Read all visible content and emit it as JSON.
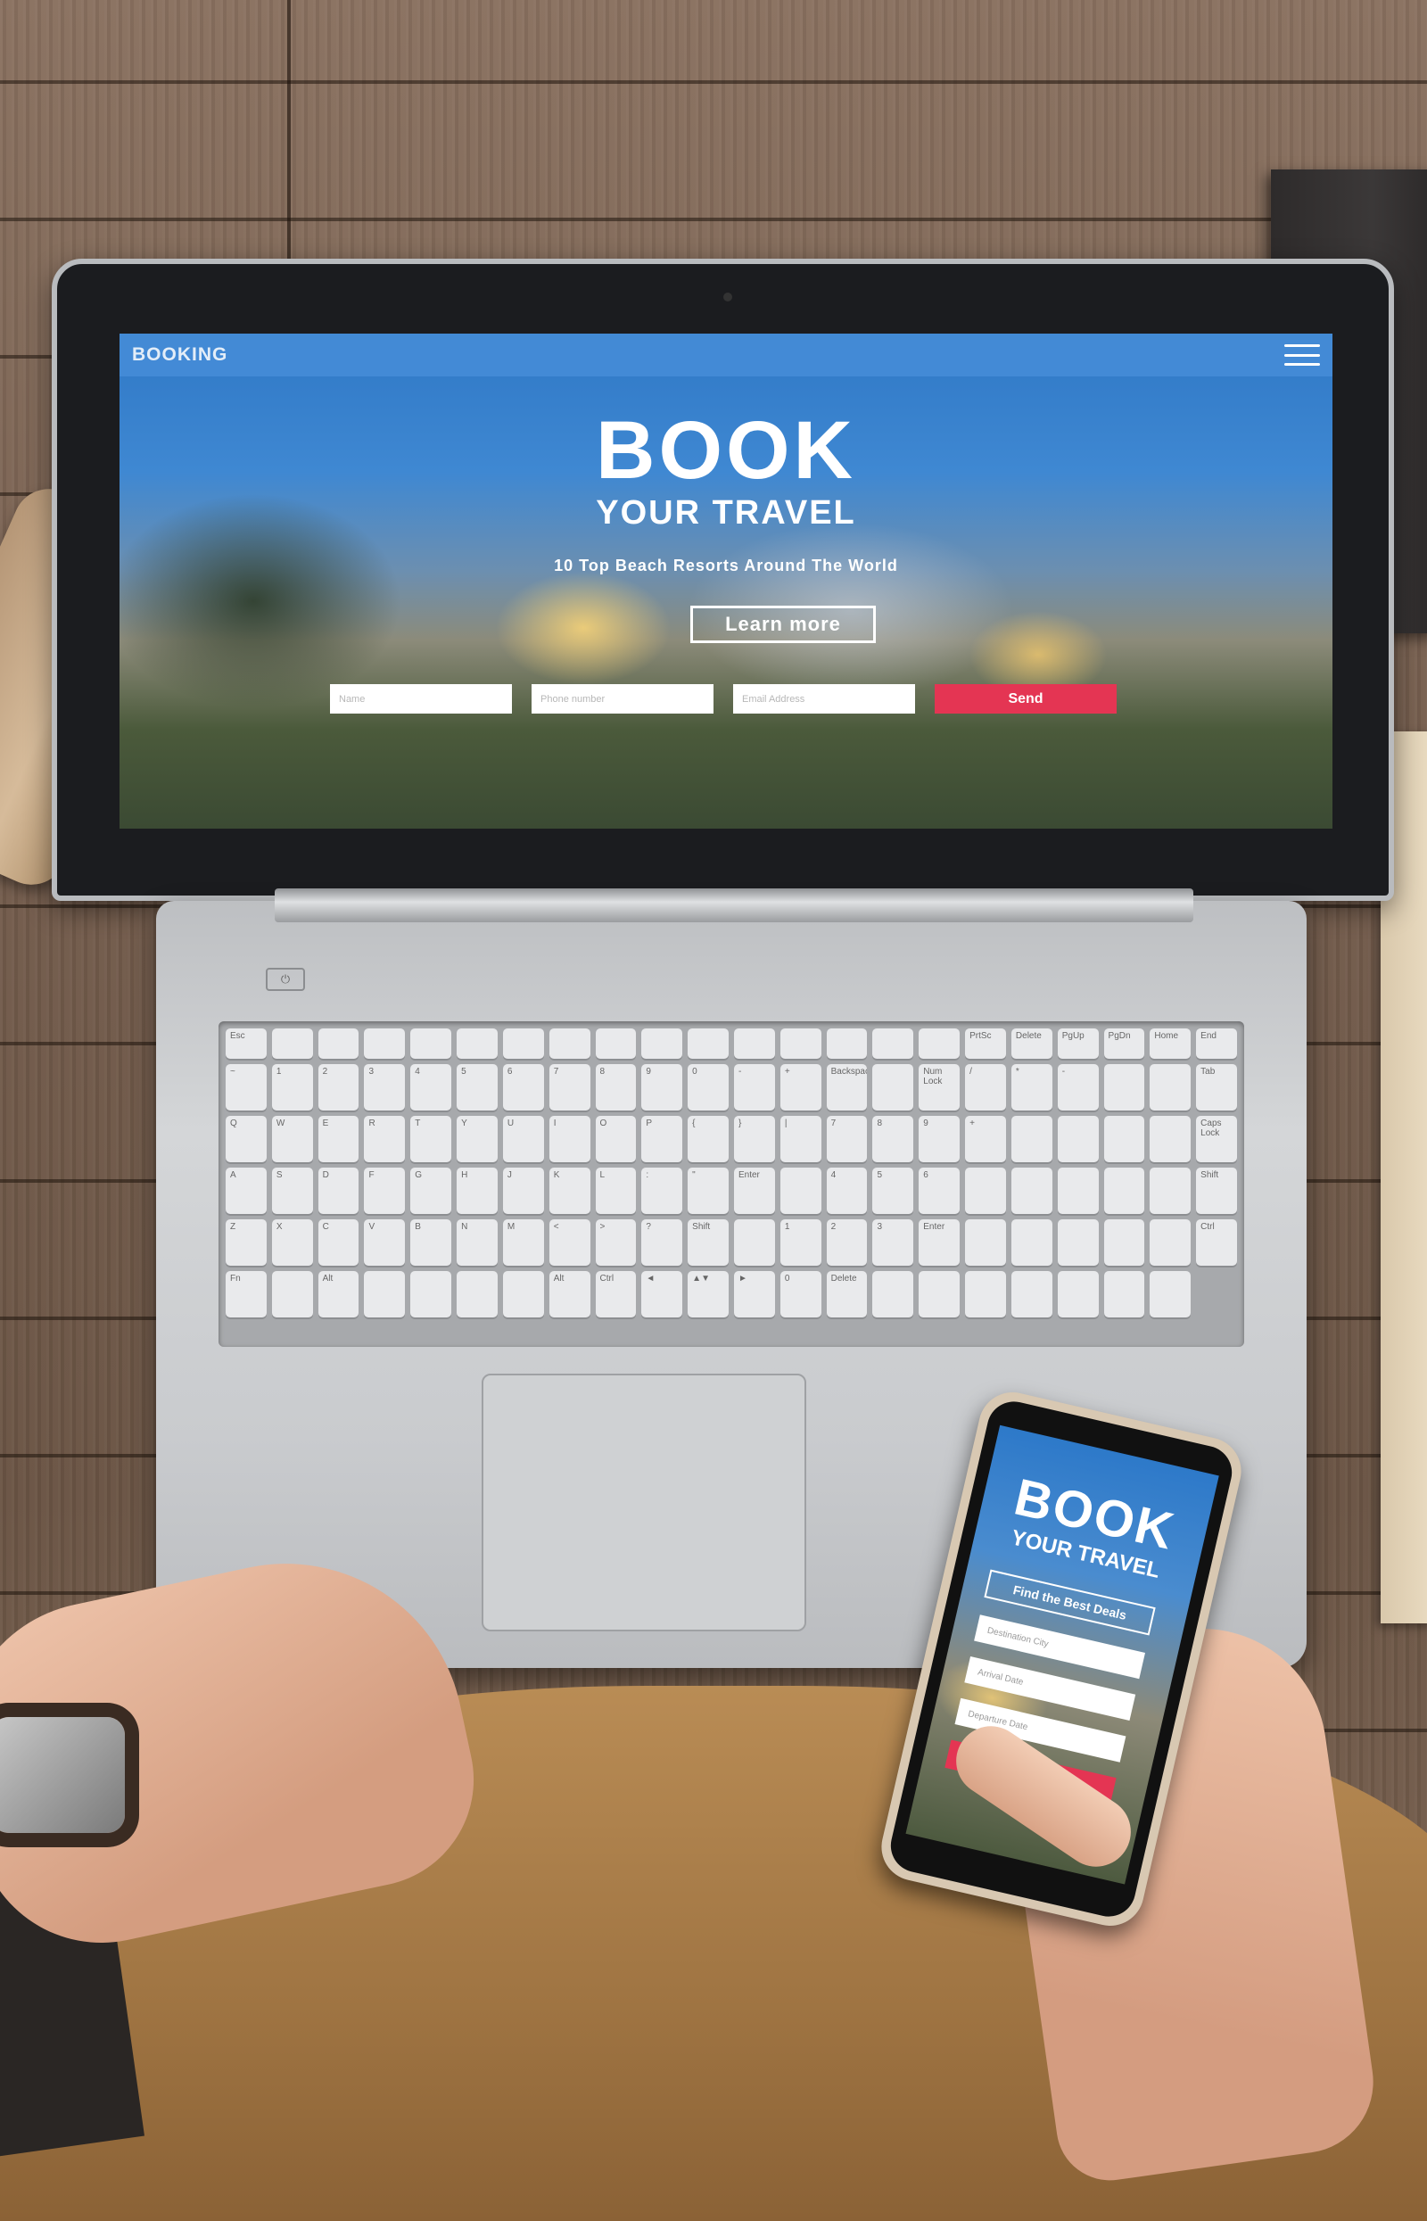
{
  "laptop_site": {
    "brand": "BOOKING",
    "hero_title": "BOOK",
    "hero_subtitle": "YOUR TRAVEL",
    "tagline": "10 Top Beach Resorts Around The World",
    "learn_more": "Learn more",
    "fields": [
      {
        "placeholder": "Name"
      },
      {
        "placeholder": "Phone number"
      },
      {
        "placeholder": "Email Address"
      }
    ],
    "send": "Send",
    "menu_icon": "hamburger-icon"
  },
  "phone_site": {
    "title": "BOOK",
    "subtitle": "YOUR TRAVEL",
    "deals_button": "Find the Best Deals",
    "fields": [
      {
        "placeholder": "Destination City"
      },
      {
        "placeholder": "Arrival Date"
      },
      {
        "placeholder": "Departure Date"
      }
    ]
  },
  "keyboard": {
    "keys": [
      "Esc",
      "",
      "",
      "",
      "",
      "",
      "",
      "",
      "",
      "",
      "",
      "",
      "",
      "",
      "",
      "",
      "PrtSc",
      "Delete",
      "PgUp",
      "PgDn",
      "Home",
      "End",
      "~",
      "1",
      "2",
      "3",
      "4",
      "5",
      "6",
      "7",
      "8",
      "9",
      "0",
      "-",
      "+",
      "Backspace",
      "",
      "Num Lock",
      "/",
      "*",
      "-",
      "",
      "",
      "Tab",
      "Q",
      "W",
      "E",
      "R",
      "T",
      "Y",
      "U",
      "I",
      "O",
      "P",
      "{",
      "}",
      "|",
      "7",
      "8",
      "9",
      "+",
      "",
      "",
      "",
      "",
      "Caps Lock",
      "A",
      "S",
      "D",
      "F",
      "G",
      "H",
      "J",
      "K",
      "L",
      ":",
      "\"",
      "Enter",
      "",
      "4",
      "5",
      "6",
      "",
      "",
      "",
      "",
      "",
      "Shift",
      "Z",
      "X",
      "C",
      "V",
      "B",
      "N",
      "M",
      "<",
      ">",
      "?",
      "Shift",
      "",
      "1",
      "2",
      "3",
      "Enter",
      "",
      "",
      "",
      "",
      "",
      "Ctrl",
      "Fn",
      "",
      "Alt",
      "",
      "",
      "",
      "",
      "Alt",
      "Ctrl",
      "◄",
      "▲▼",
      "►",
      "0",
      "Delete",
      "",
      "",
      "",
      "",
      "",
      "",
      ""
    ]
  }
}
